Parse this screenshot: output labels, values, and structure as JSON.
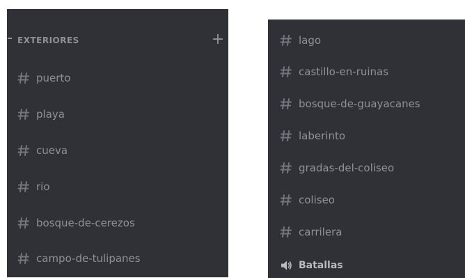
{
  "left_panel": {
    "category": {
      "label": "EXTERIORES",
      "add_symbol": "+"
    },
    "channels": [
      {
        "name": "puerto"
      },
      {
        "name": "playa"
      },
      {
        "name": "cueva"
      },
      {
        "name": "rio"
      },
      {
        "name": "bosque-de-cerezos"
      },
      {
        "name": "campo-de-tulipanes"
      }
    ]
  },
  "right_panel": {
    "channels": [
      {
        "name": "lago"
      },
      {
        "name": "castillo-en-ruinas"
      },
      {
        "name": "bosque-de-guayacanes"
      },
      {
        "name": "laberinto"
      },
      {
        "name": "gradas-del-coliseo"
      },
      {
        "name": "coliseo"
      },
      {
        "name": "carrilera"
      }
    ],
    "voice_channel": {
      "name": "Batallas",
      "icon": "speaker-icon"
    }
  },
  "colors": {
    "panel_bg": "#2f3136",
    "channel_text": "#8e9297",
    "hash_icon": "#72767d",
    "voice_text": "#b9bbbe"
  }
}
